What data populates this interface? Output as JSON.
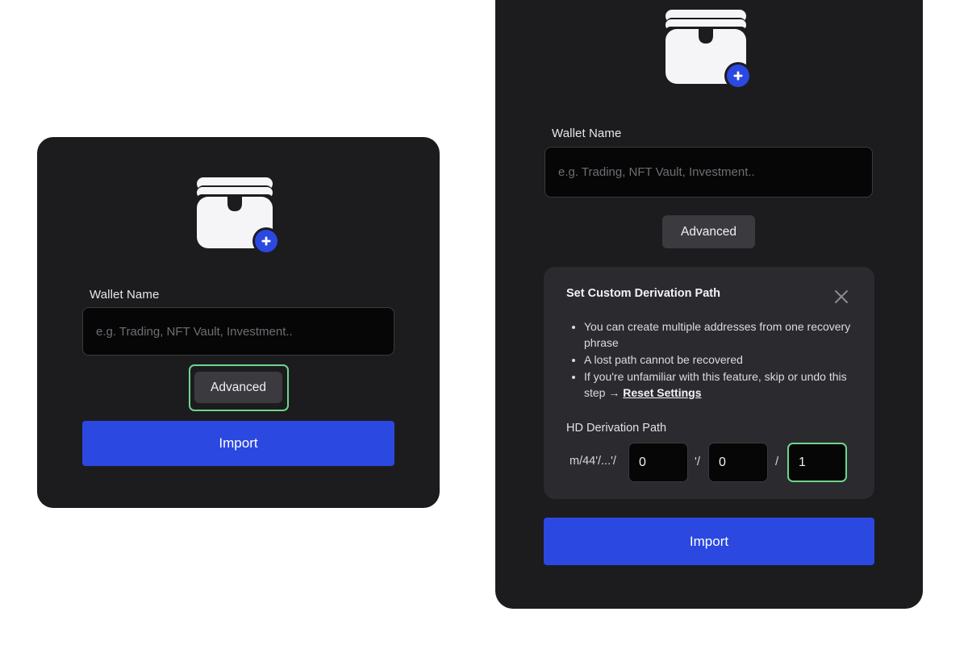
{
  "colors": {
    "panel_bg": "#1c1c1f",
    "accent_blue": "#2b48e0",
    "focus_green": "#6fd58a",
    "card_bg": "#2b2b2f"
  },
  "left_panel": {
    "wallet_icon": "wallet-add-icon",
    "wallet_name_label": "Wallet Name",
    "wallet_name_placeholder": "e.g. Trading, NFT Vault, Investment..",
    "wallet_name_value": "",
    "advanced_label": "Advanced",
    "import_label": "Import"
  },
  "right_panel": {
    "wallet_icon": "wallet-add-icon",
    "wallet_name_label": "Wallet Name",
    "wallet_name_placeholder": "e.g. Trading, NFT Vault, Investment..",
    "wallet_name_value": "",
    "advanced_label": "Advanced",
    "import_label": "Import",
    "derivation": {
      "title": "Set Custom Derivation Path",
      "close_icon": "close-icon",
      "bullets": [
        "You can create multiple addresses from one recovery phrase",
        "A lost path cannot be recovered",
        "If you're unfamiliar with this feature, skip or undo this step → "
      ],
      "reset_link": "Reset Settings",
      "hd_label": "HD Derivation Path",
      "prefix": "m/44'/...'/",
      "segments": [
        {
          "value": "0",
          "separator": "'/"
        },
        {
          "value": "0",
          "separator": "/"
        },
        {
          "value": "1"
        }
      ]
    }
  }
}
